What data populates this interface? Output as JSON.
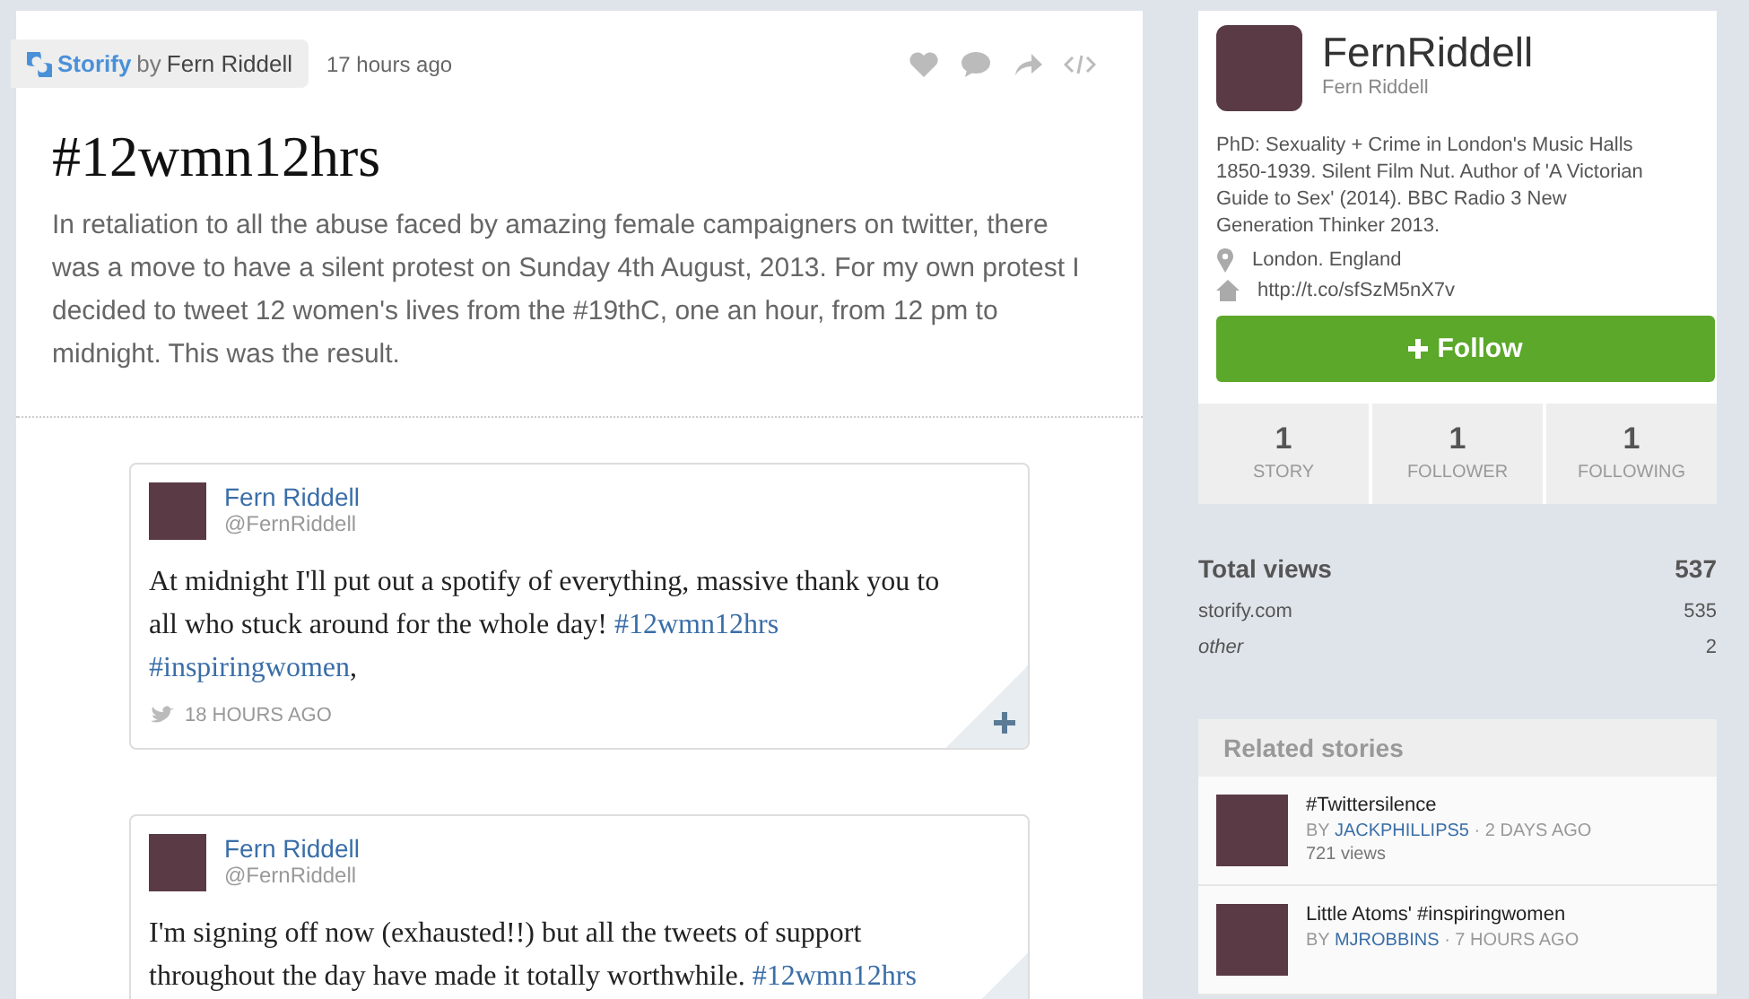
{
  "story": {
    "brand": "Storify",
    "by": "by",
    "author": "Fern Riddell",
    "time": "17 hours ago",
    "title": "#12wmn12hrs",
    "description": "In retaliation to all the abuse faced by amazing female campaigners on twitter, there was a move to have a silent protest on Sunday 4th August, 2013. For my own protest I decided to tweet 12 women's lives from the #19thC, one an hour, from 12 pm to midnight. This was the result."
  },
  "tweets": [
    {
      "name": "Fern Riddell",
      "handle": "@FernRiddell",
      "segments": [
        {
          "kind": "plain",
          "text": "At midnight I'll put out a spotify of everything, massive thank you to all who stuck around for the whole day! "
        },
        {
          "kind": "hashtag",
          "text": "#12wmn12hrs",
          "space_after": true
        },
        {
          "kind": "hashtag",
          "text": "#inspiringwomen"
        },
        {
          "kind": "plain",
          "text": ","
        }
      ],
      "time": "18 HOURS AGO"
    },
    {
      "name": "Fern Riddell",
      "handle": "@FernRiddell",
      "segments": [
        {
          "kind": "plain",
          "text": "I'm signing off now (exhausted!!) but all the tweets of support throughout the day have made it totally worthwhile. "
        },
        {
          "kind": "hashtag",
          "text": "#12wmn12hrs"
        }
      ]
    }
  ],
  "profile": {
    "username": "FernRiddell",
    "name": "Fern Riddell",
    "bio": "PhD: Sexuality + Crime in London's Music Halls 1850-1939. Silent Film Nut. Author of 'A Victorian Guide to Sex' (2014). BBC Radio 3 New Generation Thinker 2013.",
    "location": "London. England",
    "url": "http://t.co/sfSzM5nX7v",
    "follow_button": "Follow",
    "stats": [
      {
        "value": "1",
        "label": "STORY"
      },
      {
        "value": "1",
        "label": "FOLLOWER"
      },
      {
        "value": "1",
        "label": "FOLLOWING"
      }
    ]
  },
  "views": {
    "title": "Total views",
    "total": "537",
    "rows": [
      {
        "source": "storify.com",
        "count": "535",
        "italic": false
      },
      {
        "source": "other",
        "count": "2",
        "italic": true
      }
    ]
  },
  "related": {
    "title": "Related stories",
    "items": [
      {
        "title": "#Twittersilence",
        "by": "BY",
        "author": "JACKPHILLIPS5",
        "time": "· 2 DAYS AGO",
        "views": "721 views"
      },
      {
        "title": "Little Atoms' #inspiringwomen",
        "by": "BY",
        "author": "MJROBBINS",
        "time": "· 7 HOURS AGO"
      }
    ]
  }
}
